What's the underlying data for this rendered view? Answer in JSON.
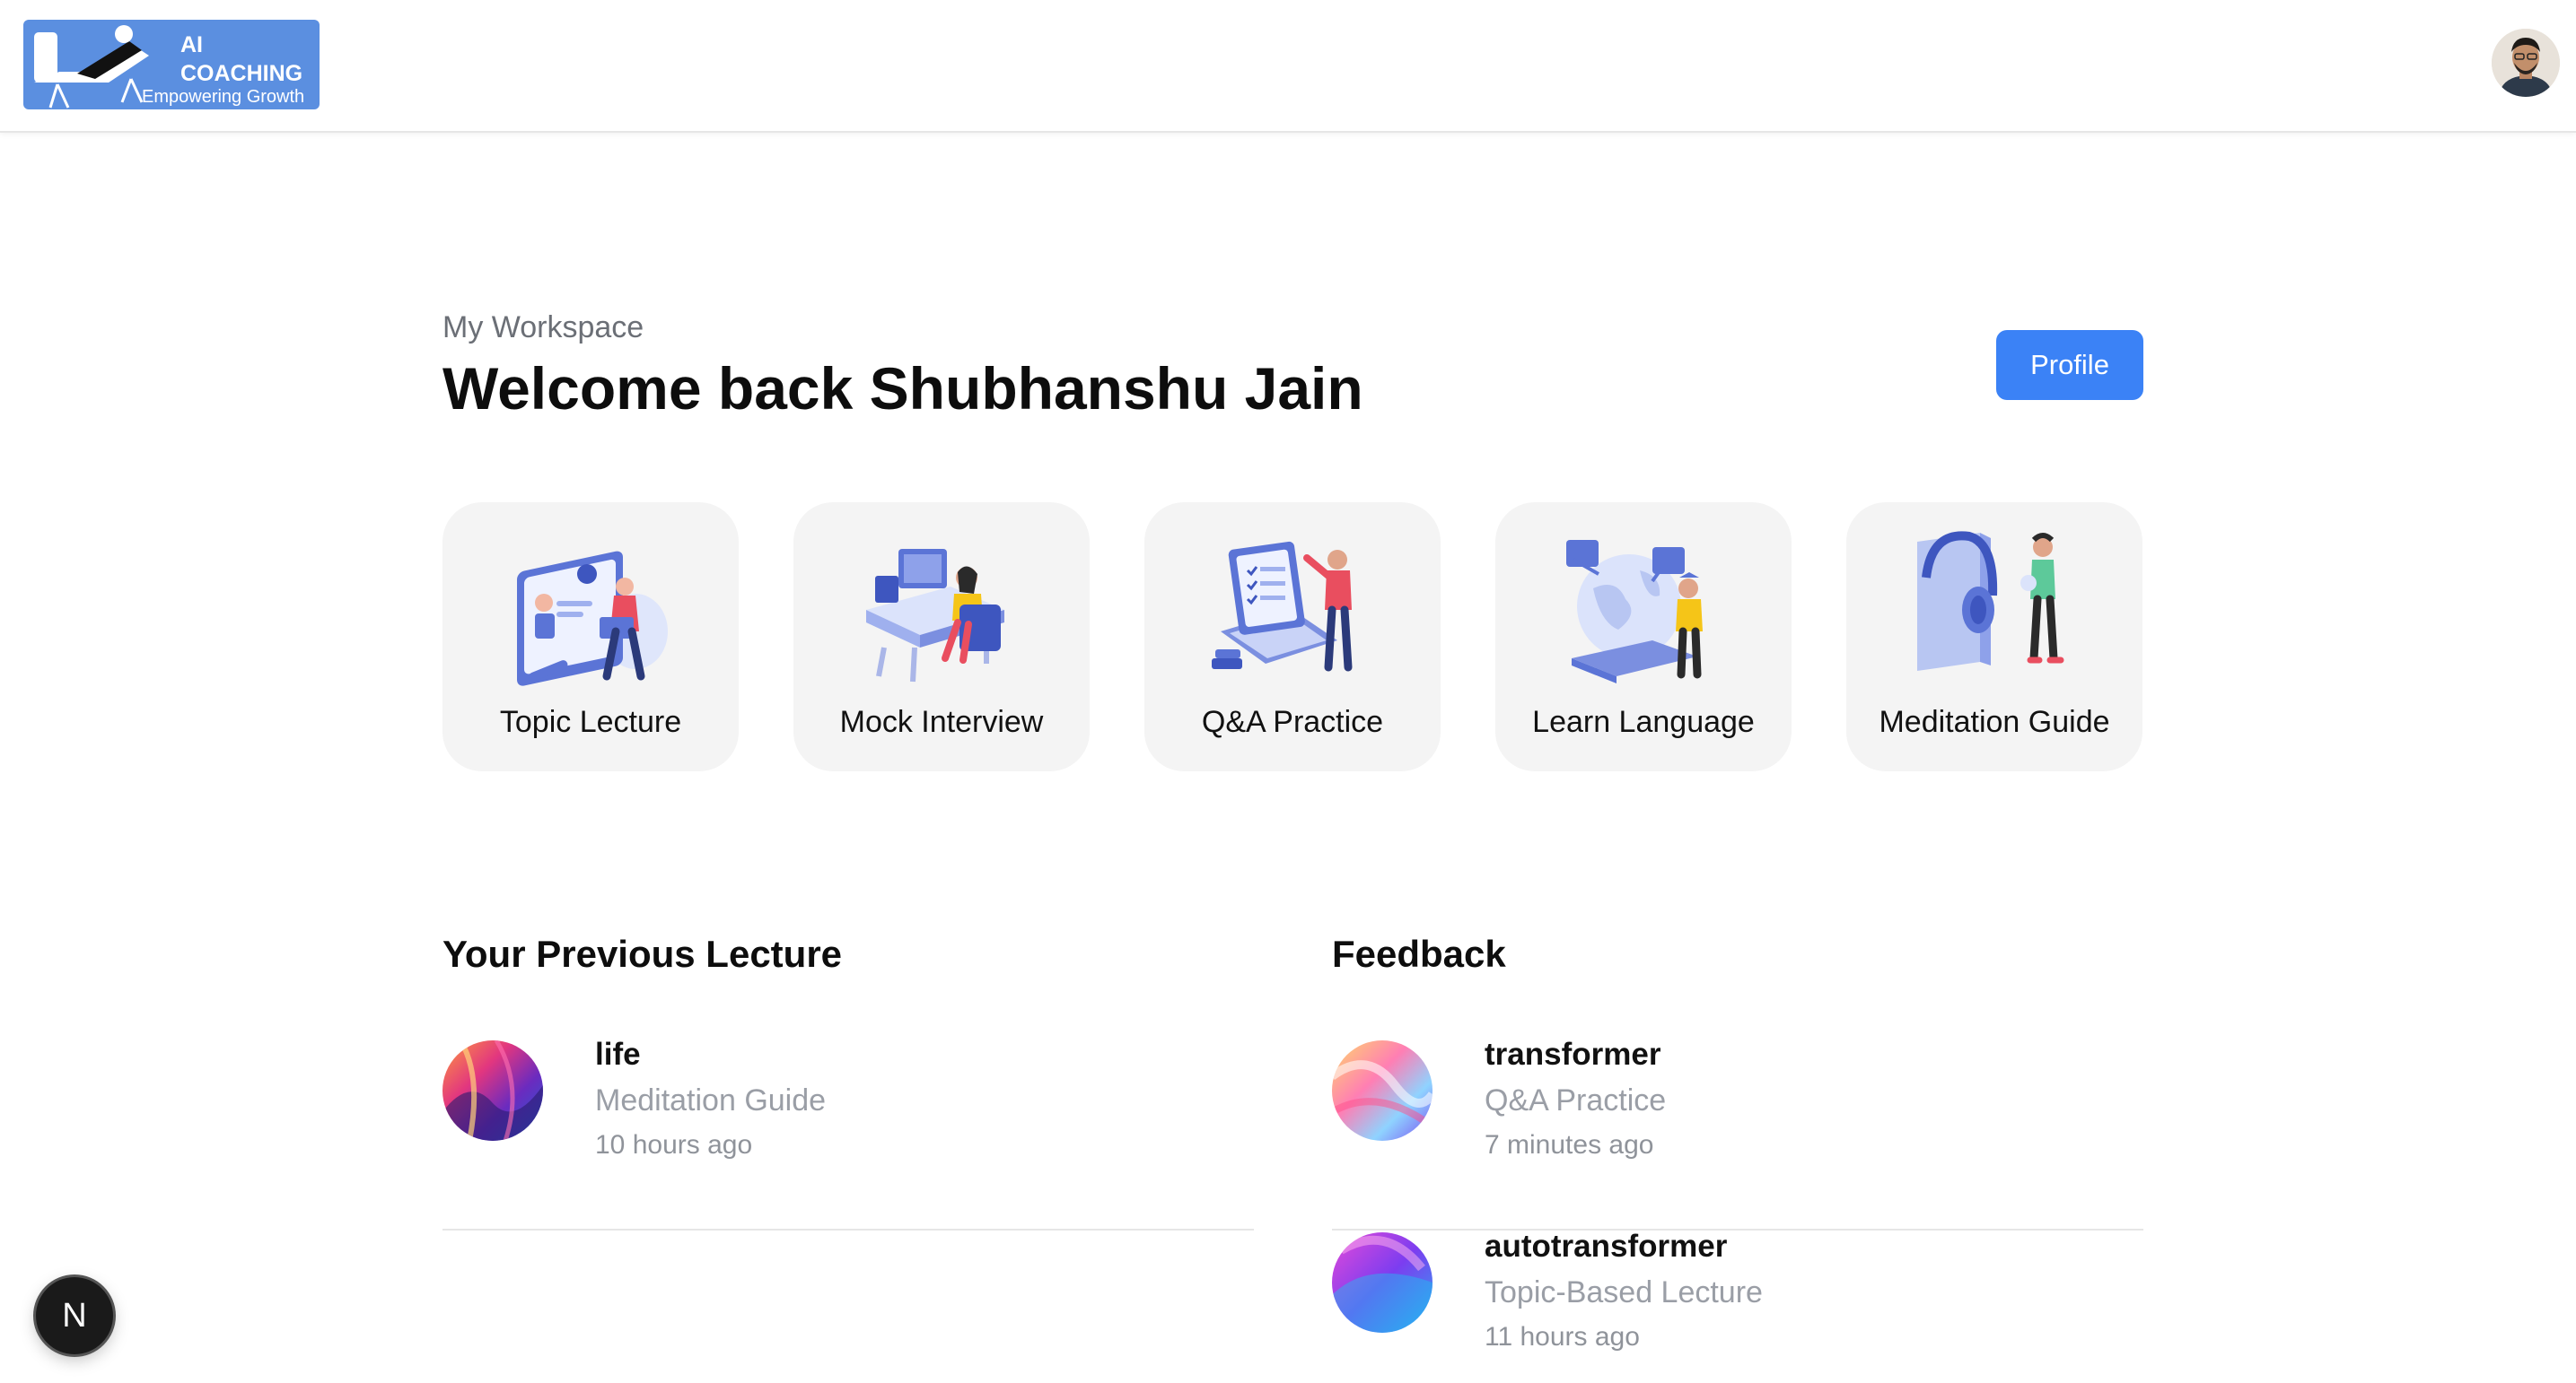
{
  "header": {
    "logo": {
      "line1": "AI",
      "line2": "COACHING",
      "tagline": "Empowering Growth"
    },
    "avatar_alt": "user avatar"
  },
  "workspace": {
    "subtitle": "My Workspace",
    "welcome": "Welcome back Shubhanshu Jain",
    "profile_label": "Profile"
  },
  "features": [
    {
      "label": "Topic Lecture",
      "icon": "teacher-screen-icon"
    },
    {
      "label": "Mock Interview",
      "icon": "desk-computer-icon"
    },
    {
      "label": "Q&A Practice",
      "icon": "laptop-checklist-icon"
    },
    {
      "label": "Learn Language",
      "icon": "globe-translate-icon"
    },
    {
      "label": "Meditation Guide",
      "icon": "headphones-book-icon"
    }
  ],
  "previous_lecture": {
    "title": "Your Previous Lecture",
    "items": [
      {
        "title": "life",
        "type": "Meditation Guide",
        "time": "10 hours ago"
      }
    ]
  },
  "feedback": {
    "title": "Feedback",
    "items": [
      {
        "title": "transformer",
        "type": "Q&A Practice",
        "time": "7 minutes ago"
      },
      {
        "title": "autotransformer",
        "type": "Topic-Based Lecture",
        "time": "11 hours ago"
      }
    ]
  },
  "dev_badge": {
    "label": "N"
  },
  "colors": {
    "primary": "#3b82f6",
    "logo_bg": "#5b8fe0",
    "card_bg": "#f4f4f4"
  }
}
